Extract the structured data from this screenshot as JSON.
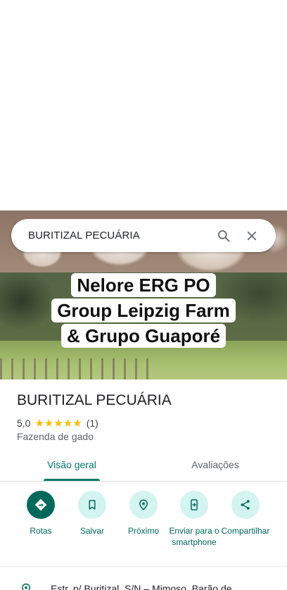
{
  "search": {
    "query": "BURITIZAL PECUÁRIA"
  },
  "hero": {
    "caption_lines": [
      "Nelore ERG PO",
      "Group Leipzig Farm",
      "& Grupo Guaporé"
    ]
  },
  "place": {
    "name": "BURITIZAL PECUÁRIA",
    "rating": "5,0",
    "stars": "★★★★★",
    "review_count": "(1)",
    "category": "Fazenda de gado"
  },
  "tabs": [
    {
      "label": "Visão geral",
      "active": true
    },
    {
      "label": "Avaliações",
      "active": false
    }
  ],
  "actions": [
    {
      "label": "Rotas",
      "icon": "directions-icon"
    },
    {
      "label": "Salvar",
      "icon": "bookmark-icon"
    },
    {
      "label": "Próximo",
      "icon": "nearby-icon"
    },
    {
      "label": "Enviar para o smartphone",
      "icon": "send-to-phone-icon"
    },
    {
      "label": "Compartilhar",
      "icon": "share-icon"
    }
  ],
  "address": "Estr. p/ Buritizal, S/N – Mimoso, Barão de",
  "colors": {
    "accent": "#00695c",
    "tab_active": "#00796b",
    "star": "#fbbc04",
    "action_bg": "#d3f4f1"
  }
}
